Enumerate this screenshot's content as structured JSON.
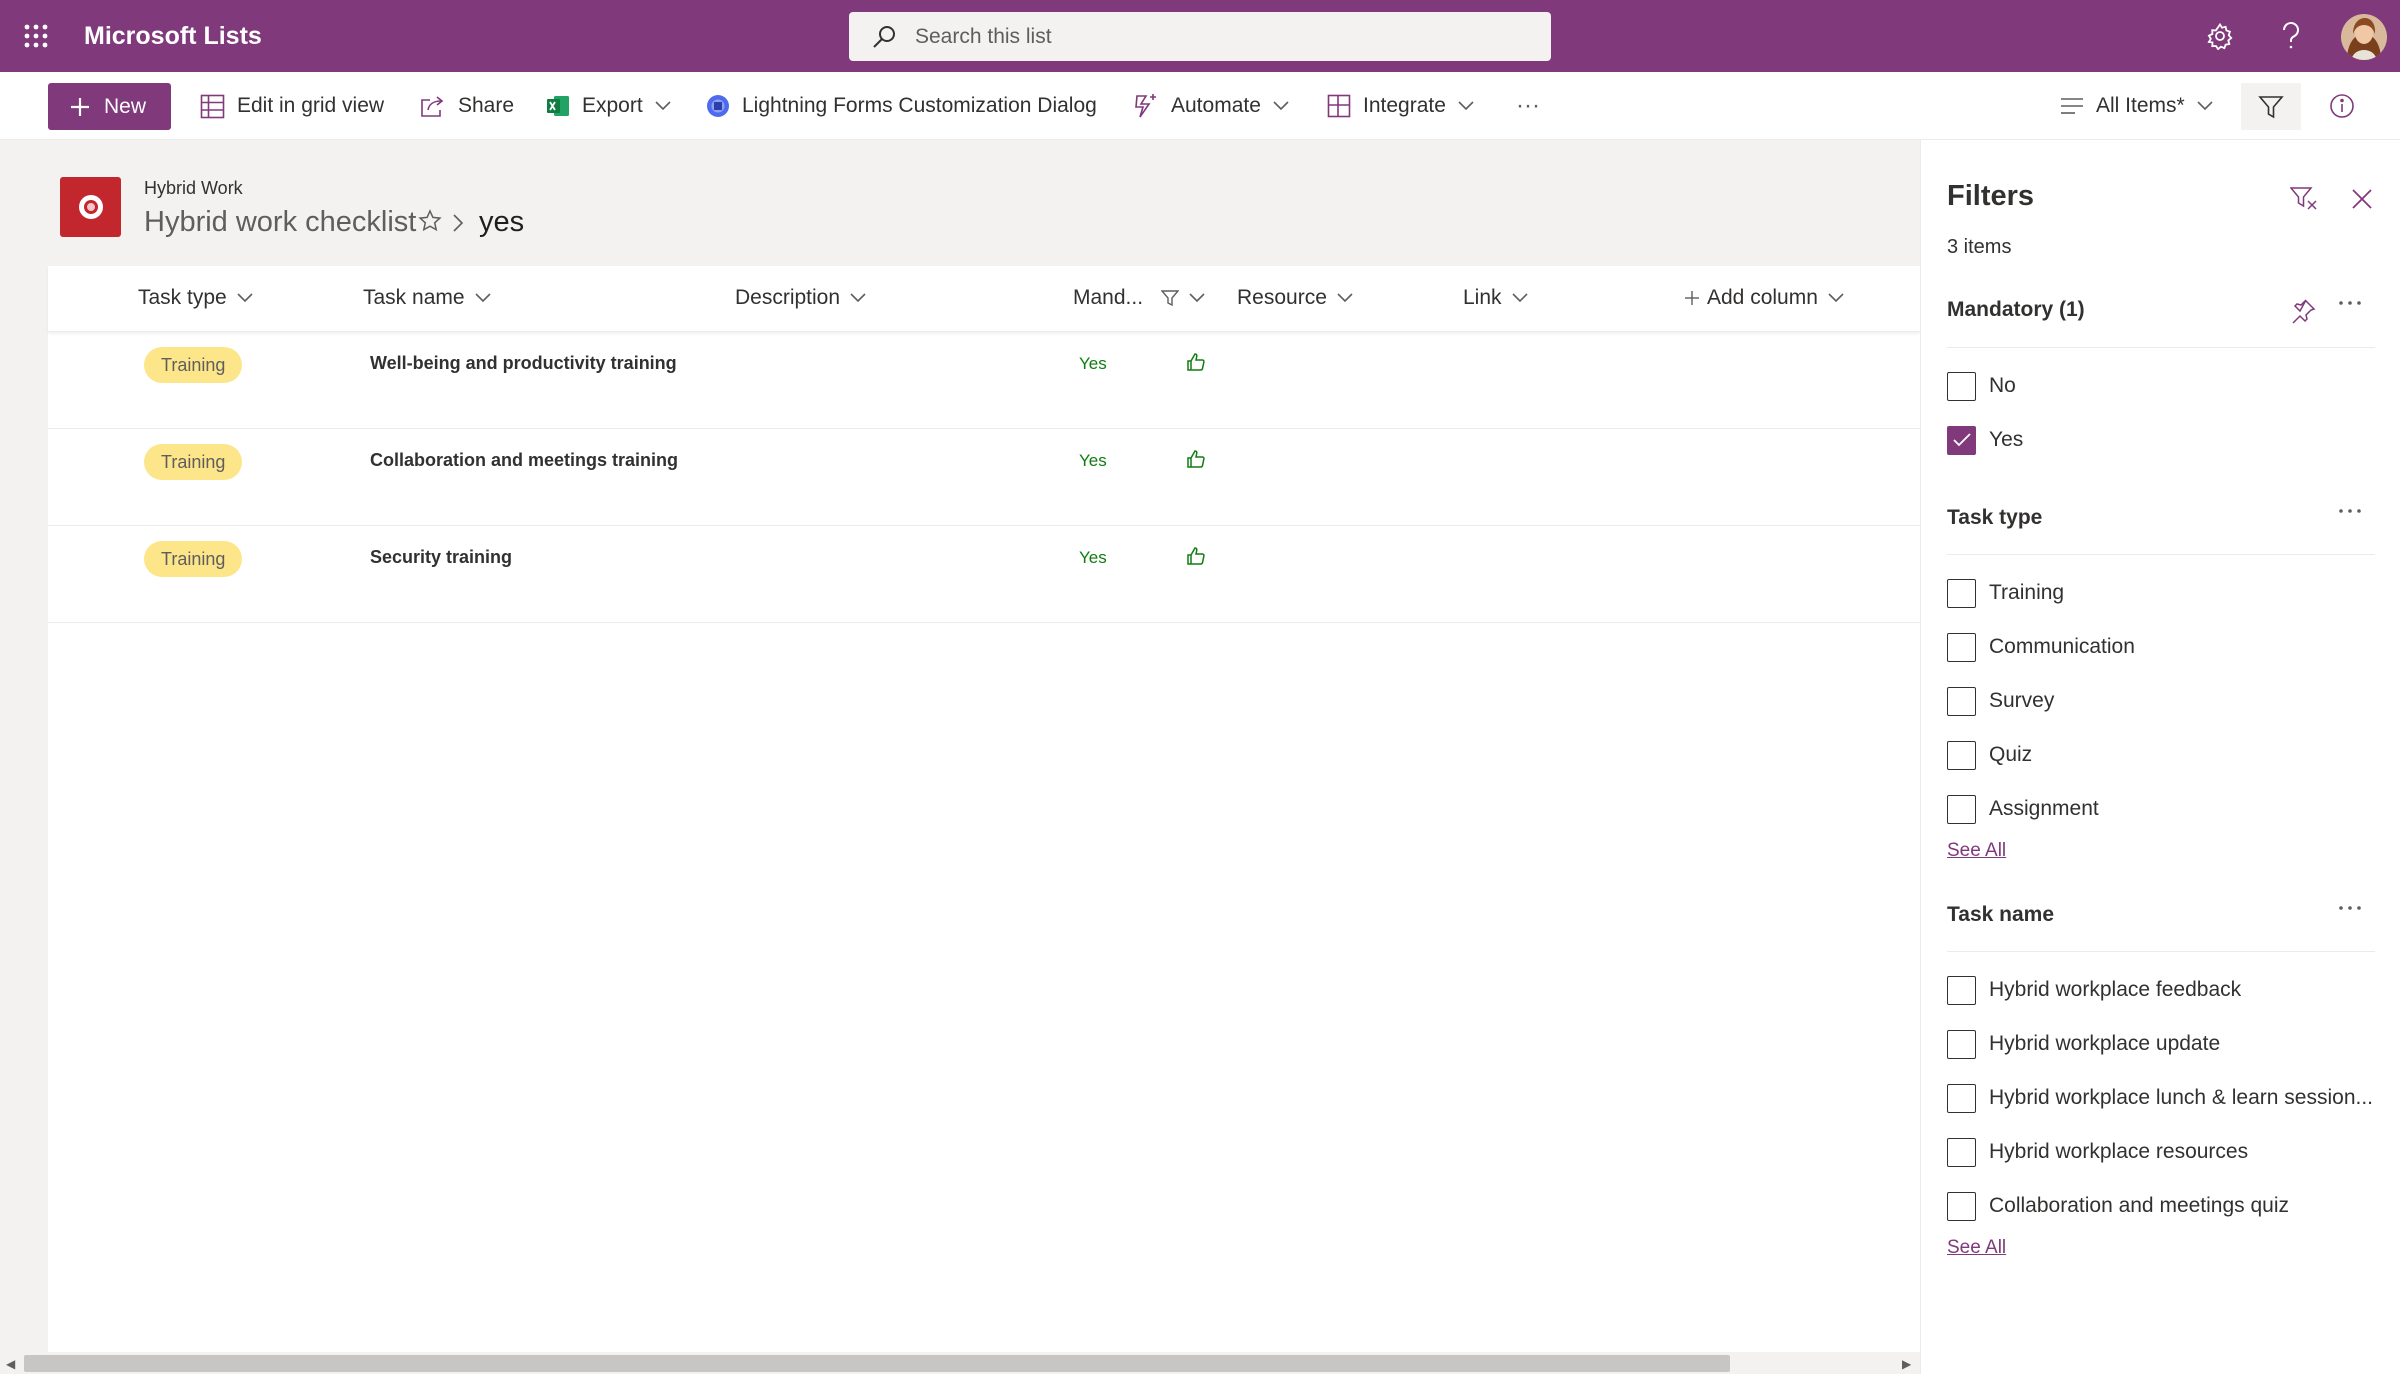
{
  "app": {
    "name": "Microsoft Lists",
    "search_placeholder": "Search this list"
  },
  "toolbar": {
    "new_label": "New",
    "edit_grid_label": "Edit in grid view",
    "share_label": "Share",
    "export_label": "Export",
    "lightning_label": "Lightning Forms Customization Dialog",
    "automate_label": "Automate",
    "integrate_label": "Integrate",
    "more_label": "···",
    "view_label": "All Items*"
  },
  "list": {
    "site": "Hybrid Work",
    "title": "Hybrid work checklist",
    "view": "yes"
  },
  "columns": {
    "task_type": "Task type",
    "task_name": "Task name",
    "description": "Description",
    "mandatory": "Mand...",
    "resource": "Resource",
    "link": "Link",
    "add_column": "Add column"
  },
  "rows": [
    {
      "task_type": "Training",
      "task_name": "Well-being and productivity training",
      "mandatory": "Yes"
    },
    {
      "task_type": "Training",
      "task_name": "Collaboration and meetings training",
      "mandatory": "Yes"
    },
    {
      "task_type": "Training",
      "task_name": "Security training",
      "mandatory": "Yes"
    }
  ],
  "filters": {
    "title": "Filters",
    "count": "3 items",
    "mandatory": {
      "title": "Mandatory (1)",
      "options": [
        {
          "label": "No",
          "checked": false
        },
        {
          "label": "Yes",
          "checked": true
        }
      ]
    },
    "task_type": {
      "title": "Task type",
      "options": [
        "Training",
        "Communication",
        "Survey",
        "Quiz",
        "Assignment"
      ],
      "see_all": "See All"
    },
    "task_name": {
      "title": "Task name",
      "options": [
        "Hybrid workplace feedback",
        "Hybrid workplace update",
        "Hybrid workplace lunch & learn session...",
        "Hybrid workplace resources",
        "Collaboration and meetings quiz"
      ],
      "see_all": "See All"
    }
  },
  "colors": {
    "brand": "#80397b",
    "pill": "#fde68a",
    "yes_text": "#107c10"
  }
}
